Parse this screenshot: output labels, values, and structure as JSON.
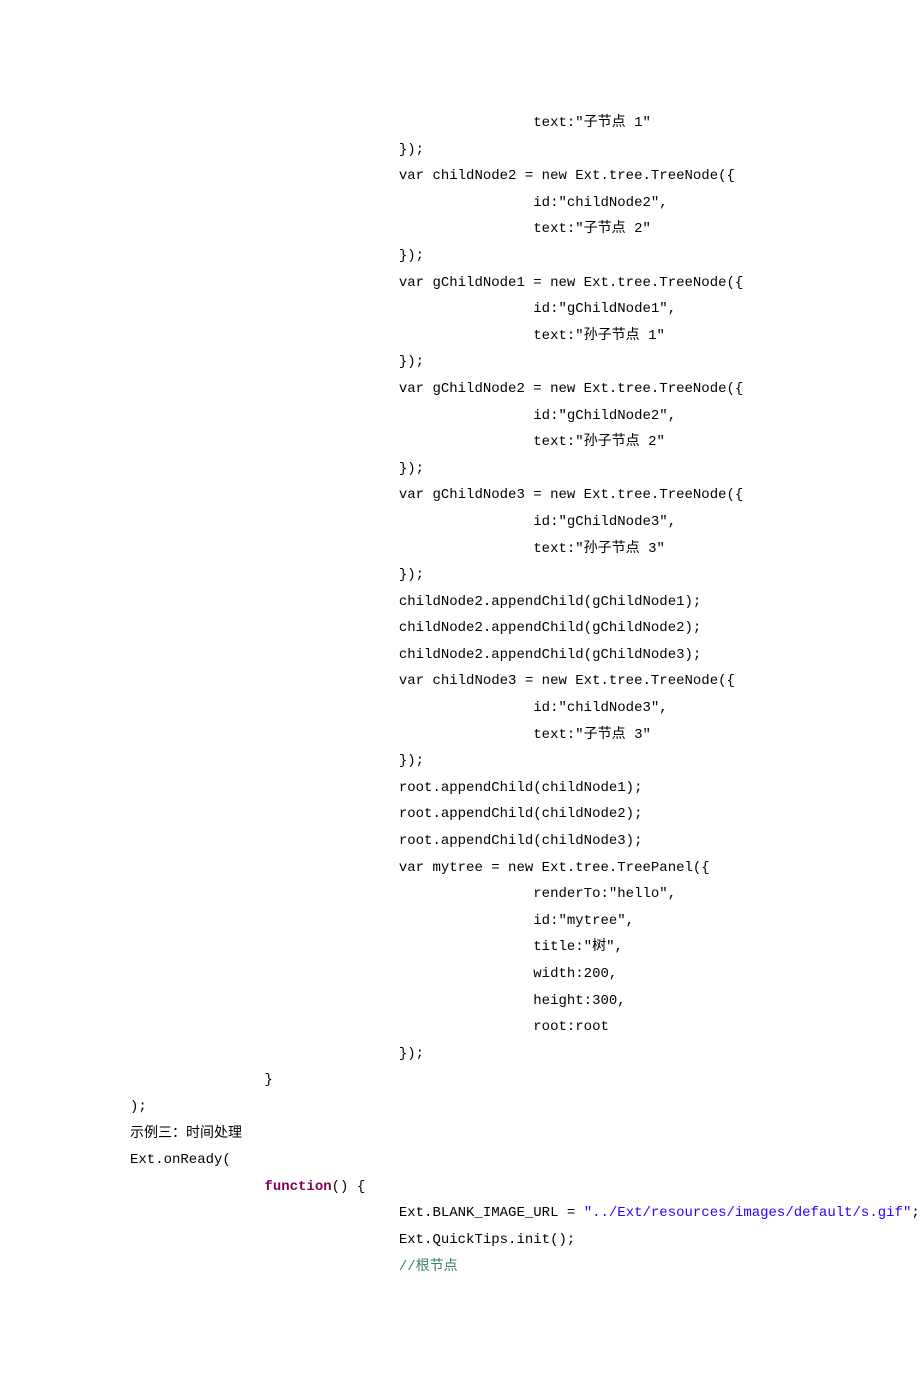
{
  "lines": [
    {
      "indent": 12,
      "segs": [
        {
          "t": "text:\"子节点 1\"",
          "c": "txt"
        }
      ]
    },
    {
      "indent": 8,
      "segs": [
        {
          "t": "});",
          "c": "txt"
        }
      ]
    },
    {
      "indent": 8,
      "segs": [
        {
          "t": "var childNode2 = new Ext.tree.TreeNode({",
          "c": "txt"
        }
      ]
    },
    {
      "indent": 12,
      "segs": [
        {
          "t": "id:\"childNode2\",",
          "c": "txt"
        }
      ]
    },
    {
      "indent": 12,
      "segs": [
        {
          "t": "text:\"子节点 2\"",
          "c": "txt"
        }
      ]
    },
    {
      "indent": 8,
      "segs": [
        {
          "t": "});",
          "c": "txt"
        }
      ]
    },
    {
      "indent": 8,
      "segs": [
        {
          "t": "var gChildNode1 = new Ext.tree.TreeNode({",
          "c": "txt"
        }
      ]
    },
    {
      "indent": 12,
      "segs": [
        {
          "t": "id:\"gChildNode1\",",
          "c": "txt"
        }
      ]
    },
    {
      "indent": 12,
      "segs": [
        {
          "t": "text:\"孙子节点 1\"",
          "c": "txt"
        }
      ]
    },
    {
      "indent": 8,
      "segs": [
        {
          "t": "});",
          "c": "txt"
        }
      ]
    },
    {
      "indent": 8,
      "segs": [
        {
          "t": "var gChildNode2 = new Ext.tree.TreeNode({",
          "c": "txt"
        }
      ]
    },
    {
      "indent": 12,
      "segs": [
        {
          "t": "id:\"gChildNode2\",",
          "c": "txt"
        }
      ]
    },
    {
      "indent": 12,
      "segs": [
        {
          "t": "text:\"孙子节点 2\"",
          "c": "txt"
        }
      ]
    },
    {
      "indent": 8,
      "segs": [
        {
          "t": "});",
          "c": "txt"
        }
      ]
    },
    {
      "indent": 8,
      "segs": [
        {
          "t": "var gChildNode3 = new Ext.tree.TreeNode({",
          "c": "txt"
        }
      ]
    },
    {
      "indent": 12,
      "segs": [
        {
          "t": "id:\"gChildNode3\",",
          "c": "txt"
        }
      ]
    },
    {
      "indent": 12,
      "segs": [
        {
          "t": "text:\"孙子节点 3\"",
          "c": "txt"
        }
      ]
    },
    {
      "indent": 8,
      "segs": [
        {
          "t": "});",
          "c": "txt"
        }
      ]
    },
    {
      "indent": 8,
      "segs": [
        {
          "t": "childNode2.appendChild(gChildNode1);",
          "c": "txt"
        }
      ]
    },
    {
      "indent": 8,
      "segs": [
        {
          "t": "childNode2.appendChild(gChildNode2);",
          "c": "txt"
        }
      ]
    },
    {
      "indent": 8,
      "segs": [
        {
          "t": "childNode2.appendChild(gChildNode3);",
          "c": "txt"
        }
      ]
    },
    {
      "indent": 8,
      "segs": [
        {
          "t": "var childNode3 = new Ext.tree.TreeNode({",
          "c": "txt"
        }
      ]
    },
    {
      "indent": 12,
      "segs": [
        {
          "t": "id:\"childNode3\",",
          "c": "txt"
        }
      ]
    },
    {
      "indent": 12,
      "segs": [
        {
          "t": "text:\"子节点 3\"",
          "c": "txt"
        }
      ]
    },
    {
      "indent": 8,
      "segs": [
        {
          "t": "});",
          "c": "txt"
        }
      ]
    },
    {
      "indent": 8,
      "segs": [
        {
          "t": "root.appendChild(childNode1);",
          "c": "txt"
        }
      ]
    },
    {
      "indent": 8,
      "segs": [
        {
          "t": "root.appendChild(childNode2);",
          "c": "txt"
        }
      ]
    },
    {
      "indent": 8,
      "segs": [
        {
          "t": "root.appendChild(childNode3);",
          "c": "txt"
        }
      ]
    },
    {
      "indent": 8,
      "segs": [
        {
          "t": "var mytree = new Ext.tree.TreePanel({",
          "c": "txt"
        }
      ]
    },
    {
      "indent": 12,
      "segs": [
        {
          "t": "renderTo:\"hello\",",
          "c": "txt"
        }
      ]
    },
    {
      "indent": 12,
      "segs": [
        {
          "t": "id:\"mytree\",",
          "c": "txt"
        }
      ]
    },
    {
      "indent": 12,
      "segs": [
        {
          "t": "title:\"树\",",
          "c": "txt"
        }
      ]
    },
    {
      "indent": 12,
      "segs": [
        {
          "t": "width:200,",
          "c": "txt"
        }
      ]
    },
    {
      "indent": 12,
      "segs": [
        {
          "t": "height:300,",
          "c": "txt"
        }
      ]
    },
    {
      "indent": 12,
      "segs": [
        {
          "t": "root:root",
          "c": "txt"
        }
      ]
    },
    {
      "indent": 8,
      "segs": [
        {
          "t": "});",
          "c": "txt"
        }
      ]
    },
    {
      "indent": 4,
      "segs": [
        {
          "t": "}",
          "c": "txt"
        }
      ]
    },
    {
      "indent": 0,
      "segs": [
        {
          "t": ");",
          "c": "txt"
        }
      ]
    },
    {
      "indent": 0,
      "segs": [
        {
          "t": "示例三：时间处理",
          "c": "txt"
        }
      ]
    },
    {
      "indent": 0,
      "segs": [
        {
          "t": "Ext.onReady(",
          "c": "txt"
        }
      ]
    },
    {
      "indent": 4,
      "segs": [
        {
          "t": "function",
          "c": "kw"
        },
        {
          "t": "() {",
          "c": "txt"
        }
      ]
    },
    {
      "indent": 8,
      "segs": [
        {
          "t": "Ext.BLANK_IMAGE_URL = ",
          "c": "txt"
        },
        {
          "t": "\"../Ext/resources/images/default/s.gif\"",
          "c": "str"
        },
        {
          "t": ";",
          "c": "txt"
        }
      ]
    },
    {
      "indent": 8,
      "segs": [
        {
          "t": "Ext.QuickTips.init();",
          "c": "txt"
        }
      ]
    },
    {
      "indent": 8,
      "segs": [
        {
          "t": "//根节点",
          "c": "cmt"
        }
      ]
    }
  ]
}
